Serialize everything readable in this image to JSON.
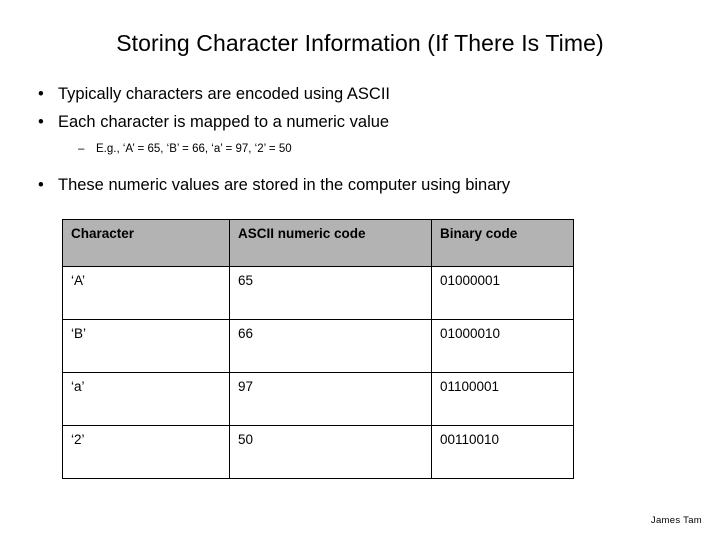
{
  "slide": {
    "title": "Storing Character Information (If There Is Time)",
    "bullets": [
      {
        "level": 1,
        "marker": "•",
        "text": "Typically characters are encoded using ASCII"
      },
      {
        "level": 1,
        "marker": "•",
        "text": "Each character is mapped to a numeric value"
      },
      {
        "level": 2,
        "marker": "–",
        "text": "E.g., ‘A’ = 65, ‘B’ = 66, ‘a’ = 97, ‘2’ = 50"
      },
      {
        "level": 1,
        "marker": "•",
        "text": "These numeric values are stored in the computer using binary"
      }
    ],
    "table": {
      "headers": [
        "Character",
        "ASCII numeric code",
        "Binary code"
      ],
      "rows": [
        [
          "‘A’",
          "65",
          "01000001"
        ],
        [
          "‘B’",
          "66",
          "01000010"
        ],
        [
          "‘a’",
          "97",
          "01100001"
        ],
        [
          "‘2’",
          "50",
          "00110010"
        ]
      ]
    },
    "footer": "James Tam"
  }
}
